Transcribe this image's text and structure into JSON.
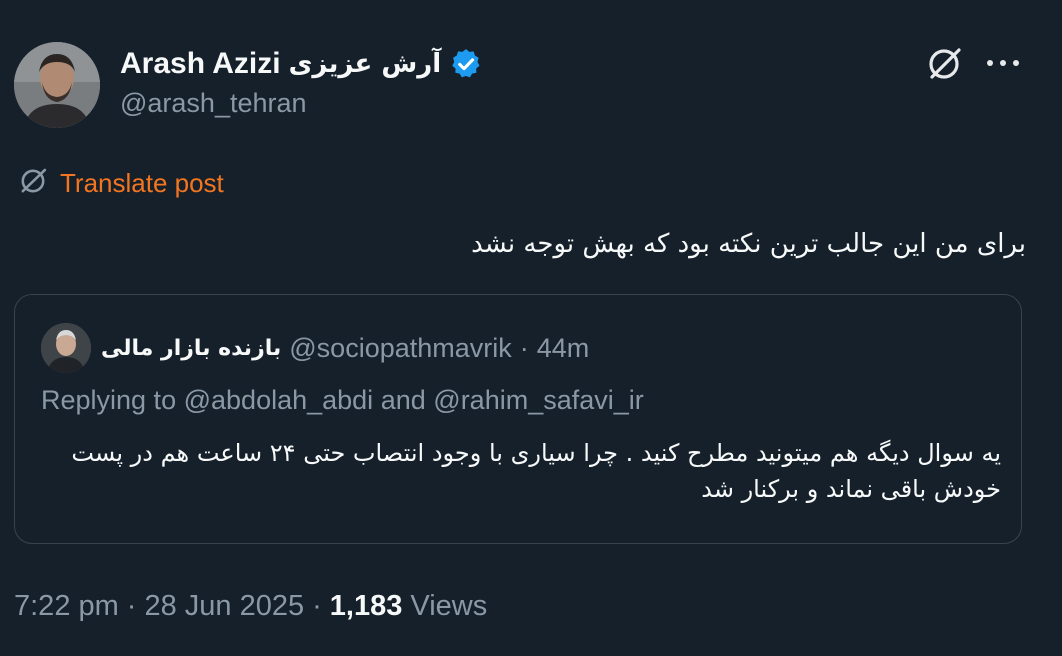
{
  "author": {
    "name": "Arash Azizi",
    "name_fa": "آرش عزیزی",
    "handle": "@arash_tehran",
    "verified_color": "#1d9bf0"
  },
  "icons": {
    "grok": "grok-icon",
    "more": "more-icon",
    "translate": "translate-icon",
    "verified": "verified-badge-icon"
  },
  "translate_label": "Translate post",
  "tweet_text": "برای من این جالب ترین نکته بود که بهش توجه نشد",
  "quote": {
    "name": "بازنده بازار مالی",
    "handle": "@sociopathmavrik",
    "separator": "·",
    "time": "44m",
    "replying_prefix": "Replying to",
    "mention_1": "@abdolah_abdi",
    "and": "and",
    "mention_2": "@rahim_safavi_ir",
    "text": "یه سوال دیگه هم میتونید مطرح کنید . چرا سیاری با وجود انتصاب حتی ۲۴ ساعت هم در پست خودش باقی نماند و برکنار شد"
  },
  "meta": {
    "time": "7:22 pm",
    "separator": "·",
    "date": "28 Jun 2025",
    "views_count": "1,183",
    "views_label": "Views"
  },
  "colors": {
    "background": "#15202b",
    "accent_translate": "#f4751f",
    "secondary_text": "#8b98a5",
    "border": "#38444d"
  }
}
